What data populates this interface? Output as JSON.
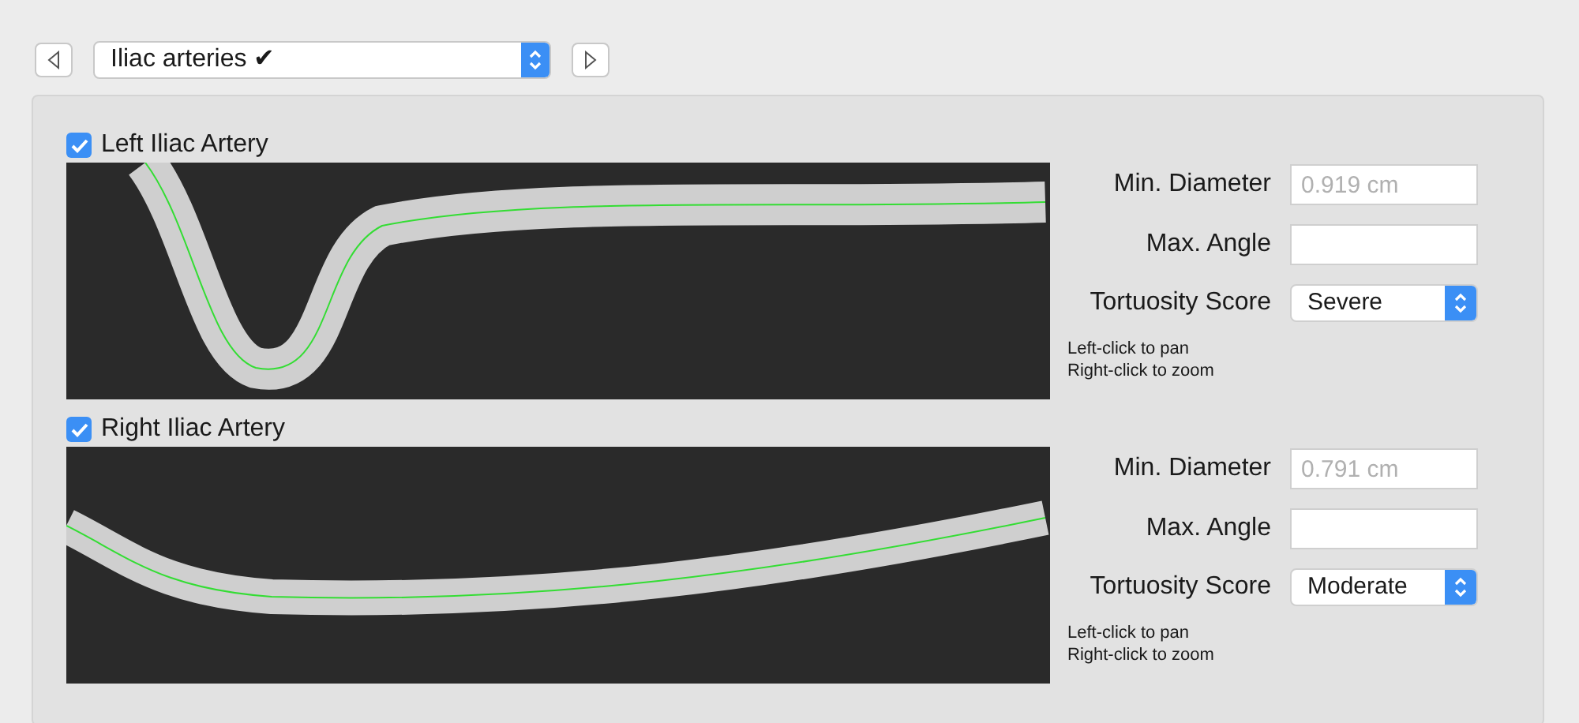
{
  "navigator": {
    "selection": "Iliac arteries ✔"
  },
  "sections": [
    {
      "title": "Left Iliac Artery",
      "checked": true,
      "min_diameter": {
        "label": "Min. Diameter",
        "placeholder": "0.919 cm"
      },
      "max_angle": {
        "label": "Max. Angle"
      },
      "tortuosity": {
        "label": "Tortuosity Score",
        "value": "Severe"
      },
      "hints": [
        "Left-click to pan",
        "Right-click to zoom"
      ]
    },
    {
      "title": "Right Iliac Artery",
      "checked": true,
      "min_diameter": {
        "label": "Min. Diameter",
        "placeholder": "0.791 cm"
      },
      "max_angle": {
        "label": "Max. Angle"
      },
      "tortuosity": {
        "label": "Tortuosity Score",
        "value": "Moderate"
      },
      "hints": [
        "Left-click to pan",
        "Right-click to zoom"
      ]
    }
  ]
}
